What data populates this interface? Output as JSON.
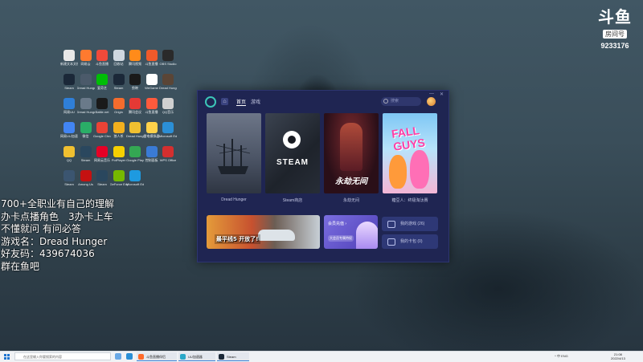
{
  "watermark": {
    "logo": "斗鱼",
    "room_label": "房间号",
    "room_id": "9233176"
  },
  "desktop_icons": [
    {
      "label": "新建文本文档",
      "color": "#e8e8e8"
    },
    {
      "label": "网易云",
      "color": "#ff7a2f"
    },
    {
      "label": "斗鱼直播",
      "color": "#f04a3a"
    },
    {
      "label": "回收站",
      "color": "#cfd8e0"
    },
    {
      "label": "腾讯视频",
      "color": "#ff8b1a"
    },
    {
      "label": "斗鱼直播",
      "color": "#f05a2a"
    },
    {
      "label": "OBS Studio",
      "color": "#2a2a2a"
    },
    {
      "label": "Steam",
      "color": "#1b2838"
    },
    {
      "label": "Dread Hunger",
      "color": "#4b5a6a"
    },
    {
      "label": "爱奇艺",
      "color": "#00be06"
    },
    {
      "label": "Steam",
      "color": "#1b2838"
    },
    {
      "label": "剪映",
      "color": "#1a1a1a"
    },
    {
      "label": "WeGame",
      "color": "#ffffff"
    },
    {
      "label": "Dread Hunger",
      "color": "#5a4536"
    },
    {
      "label": "网易UU",
      "color": "#2f7fd8"
    },
    {
      "label": "Dread Hunger",
      "color": "#6a7a8a"
    },
    {
      "label": "Battle.net",
      "color": "#1a1a1a"
    },
    {
      "label": "Origin",
      "color": "#f56c2d"
    },
    {
      "label": "腾讯会议",
      "color": "#e53935"
    },
    {
      "label": "斗鱼直播",
      "color": "#ff5a3c"
    },
    {
      "label": "QQ音乐",
      "color": "#d0d0d0"
    },
    {
      "label": "网易UU加速器",
      "color": "#4285f4"
    },
    {
      "label": "微信",
      "color": "#2aae67"
    },
    {
      "label": "Google Chrome",
      "color": "#ea4335"
    },
    {
      "label": "狼人杀",
      "color": "#f2b01e"
    },
    {
      "label": "Dread Hunger",
      "color": "#f0c030"
    },
    {
      "label": "雷电模拟器",
      "color": "#ffd24a"
    },
    {
      "label": "Microsoft Edge",
      "color": "#2b8fd6"
    },
    {
      "label": "QQ",
      "color": "#f0c030"
    },
    {
      "label": "Steam",
      "color": "#2a475e"
    },
    {
      "label": "网易云音乐",
      "color": "#e60026"
    },
    {
      "label": "PotPlayer",
      "color": "#f5d000"
    },
    {
      "label": "Google Play",
      "color": "#34a853"
    },
    {
      "label": "控制面板",
      "color": "#3a7bd5"
    },
    {
      "label": "WPS Office",
      "color": "#d32f2f"
    },
    {
      "label": "Steam",
      "color": "#3b5570"
    },
    {
      "label": "Among Us",
      "color": "#c51111"
    },
    {
      "label": "Steam",
      "color": "#2a475e"
    },
    {
      "label": "GeForce Experience",
      "color": "#76b900"
    },
    {
      "label": "Microsoft Edge",
      "color": "#1e9ae0"
    }
  ],
  "overlay_text": [
    "700+全职业有自己的理解",
    "办卡点播角色　3办卡上车",
    "不懂就问 有问必答",
    "游戏名：Dread Hunger",
    "好友码：439674036",
    "群在鱼吧"
  ],
  "launcher": {
    "tabs": [
      "首页",
      "游戏"
    ],
    "search_placeholder": "搜索",
    "window_controls": [
      "—",
      "✕"
    ],
    "games": [
      {
        "caption": "Dread Hunger"
      },
      {
        "caption": "Steam商店",
        "logo_text": "STEAM"
      },
      {
        "caption": "永劫无间",
        "logo_text": "永劫无间"
      },
      {
        "caption": "糖豆人：终极淘汰赛",
        "logo_text": "FALL GUYS"
      }
    ],
    "banner_text": "最平线5 开放了!",
    "member": {
      "title": "会员充值 ›",
      "sub": "大会员专属特权"
    },
    "side_buttons": [
      {
        "label": "我的游戏 (26)"
      },
      {
        "label": "我的卡包 (0)"
      }
    ]
  },
  "taskbar": {
    "search_placeholder": "在这里输入你要搜索的内容",
    "apps": [
      {
        "label": "斗鱼直播伴侣",
        "color": "#ff6a2a"
      },
      {
        "label": "UU加速器",
        "color": "#2aa8c8"
      },
      {
        "label": "Steam",
        "color": "#1b2838"
      }
    ],
    "clock_time": "21:08",
    "clock_date": "2022/4/13",
    "tray": "^ 中 ENG"
  }
}
